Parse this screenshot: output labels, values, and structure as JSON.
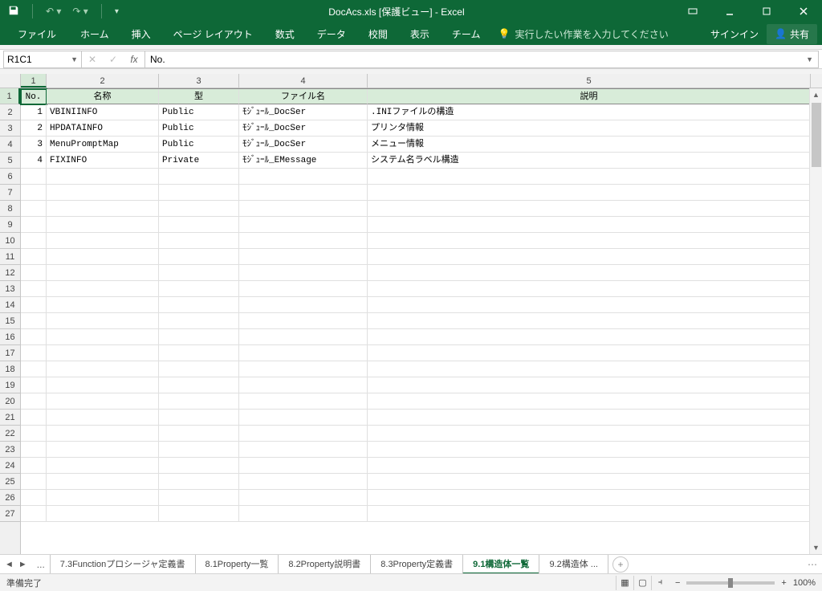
{
  "title": "DocAcs.xls  [保護ビュー] - Excel",
  "ribbon": {
    "file": "ファイル",
    "tabs": [
      "ホーム",
      "挿入",
      "ページ レイアウト",
      "数式",
      "データ",
      "校閲",
      "表示",
      "チーム"
    ],
    "tell_me": "実行したい作業を入力してください",
    "sign_in": "サインイン",
    "share": "共有"
  },
  "name_box": "R1C1",
  "formula": "No.",
  "col_headers": [
    "1",
    "2",
    "3",
    "4",
    "5"
  ],
  "row_headers": [
    "1",
    "2",
    "3",
    "4",
    "5",
    "6",
    "7",
    "8",
    "9",
    "10",
    "11",
    "12",
    "13",
    "14",
    "15",
    "16",
    "17",
    "18",
    "19",
    "20",
    "21",
    "22",
    "23",
    "24",
    "25",
    "26",
    "27"
  ],
  "header_row": [
    "No.",
    "名称",
    "型",
    "ファイル名",
    "説明"
  ],
  "data_rows": [
    [
      "1",
      "VBINIINFO",
      "Public",
      "ﾓｼﾞｭｰﾙ_DocSer",
      ".INIファイルの構造"
    ],
    [
      "2",
      "HPDATAINFO",
      "Public",
      "ﾓｼﾞｭｰﾙ_DocSer",
      "プリンタ情報"
    ],
    [
      "3",
      "MenuPromptMap",
      "Public",
      "ﾓｼﾞｭｰﾙ_DocSer",
      "メニュー情報"
    ],
    [
      "4",
      "FIXINFO",
      "Private",
      "ﾓｼﾞｭｰﾙ_EMessage",
      "システム名ラベル構造"
    ]
  ],
  "sheet_tabs": {
    "visible": [
      "7.3Functionプロシージャ定義書",
      "8.1Property一覧",
      "8.2Property説明書",
      "8.3Property定義書",
      "9.1構造体一覧",
      "9.2構造体 ..."
    ],
    "active_index": 4
  },
  "status": {
    "ready": "準備完了",
    "zoom": "100%"
  }
}
